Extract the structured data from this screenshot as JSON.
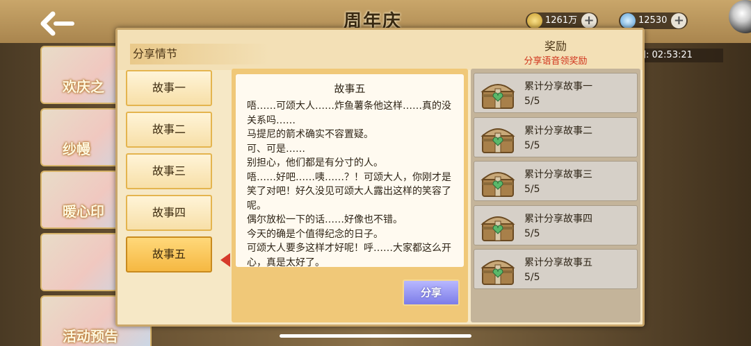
{
  "header": {
    "title": "周年庆",
    "back_icon": "chevron-left-icon",
    "gold_amount": "1261万",
    "gem_amount": "12530",
    "timer": "间: 02:53:21"
  },
  "background_banners": [
    "欢庆之",
    "纱幔",
    "暖心印",
    "",
    "活动预告"
  ],
  "dialog": {
    "title": "分享情节",
    "reward_title": "奖励",
    "reward_subtitle": "分享语音领奖励",
    "tabs": [
      "故事一",
      "故事二",
      "故事三",
      "故事四",
      "故事五"
    ],
    "active_tab": 4,
    "story": {
      "title": "故事五",
      "lines": [
        "唔……可颂大人……炸鱼薯条他这样……真的没关系吗……",
        "马提尼的箭术确实不容置疑。",
        "可、可是……",
        "别担心，他们都是有分寸的人。",
        "唔……好吧……咦……？！可颂大人，你刚才是笑了对吧！好久没见可颂大人露出这样的笑容了呢。",
        "偶尔放松一下的话……好像也不错。",
        "今天的确是个值得纪念的日子。",
        "可颂大人要多这样才好呢！呼……大家都这么开心，真是太好了。"
      ]
    },
    "share_button": "分享",
    "rewards": [
      {
        "label": "累计分享故事一",
        "progress": "5/5"
      },
      {
        "label": "累计分享故事二",
        "progress": "5/5"
      },
      {
        "label": "累计分享故事三",
        "progress": "5/5"
      },
      {
        "label": "累计分享故事四",
        "progress": "5/5"
      },
      {
        "label": "累计分享故事五",
        "progress": "5/5"
      }
    ]
  }
}
